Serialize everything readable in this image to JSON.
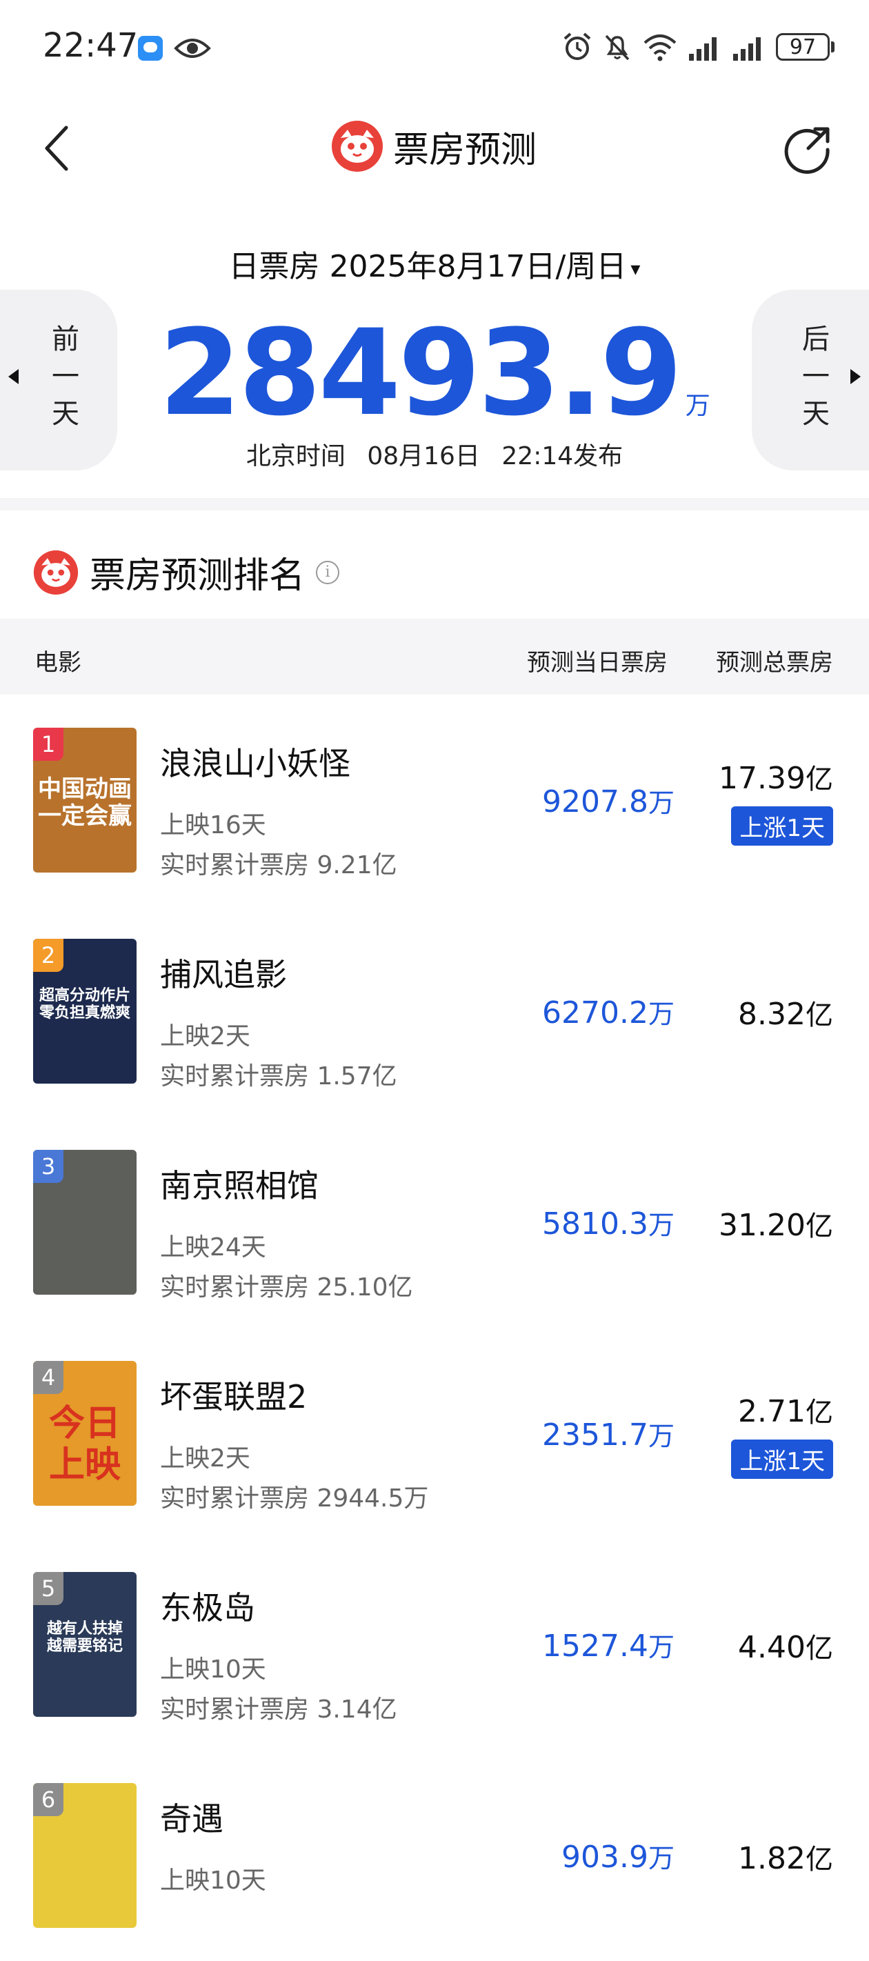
{
  "status_bar": {
    "time": "22:47",
    "battery": "97",
    "icons": [
      "message-icon",
      "eye-icon",
      "alarm-icon",
      "mute-icon",
      "wifi-icon",
      "signal-icon",
      "signal-icon",
      "battery-icon"
    ]
  },
  "header": {
    "title": "票房预测",
    "icons": [
      "back-icon",
      "cat-logo-icon",
      "share-icon"
    ]
  },
  "date": {
    "prefix": "日票房",
    "value": "2025年8月17日/周日",
    "caret": "▾"
  },
  "box_office": {
    "value": "28493.9",
    "unit": "万"
  },
  "publish": {
    "label": "北京时间",
    "date": "08月16日",
    "time": "22:14发布"
  },
  "nav": {
    "prev": "前一天",
    "next": "后一天"
  },
  "ranking": {
    "title": "票房预测排名",
    "columns": [
      "电影",
      "预测当日票房",
      "预测总票房"
    ],
    "rows": [
      {
        "rank": "1",
        "title": "浪浪山小妖怪",
        "days": "上映16天",
        "cumulative": "实时累计票房 9.21亿",
        "today": "9207.8",
        "today_unit": "万",
        "total": "17.39",
        "total_unit": "亿",
        "badge": "上涨1天",
        "poster_text": "中国动画\n一定会赢",
        "poster_color": "#b8722c",
        "rank_color": "#e8384a"
      },
      {
        "rank": "2",
        "title": "捕风追影",
        "days": "上映2天",
        "cumulative": "实时累计票房 1.57亿",
        "today": "6270.2",
        "today_unit": "万",
        "total": "8.32",
        "total_unit": "亿",
        "badge": "",
        "poster_text": "超高分动作片\n零负担真燃爽",
        "poster_color": "#1d2a4e",
        "rank_color": "#f49b2a"
      },
      {
        "rank": "3",
        "title": "南京照相馆",
        "days": "上映24天",
        "cumulative": "实时累计票房 25.10亿",
        "today": "5810.3",
        "today_unit": "万",
        "total": "31.20",
        "total_unit": "亿",
        "badge": "",
        "poster_text": "",
        "poster_color": "#5d5f5a",
        "rank_color": "#4a78d6"
      },
      {
        "rank": "4",
        "title": "坏蛋联盟2",
        "days": "上映2天",
        "cumulative": "实时累计票房 2944.5万",
        "today": "2351.7",
        "today_unit": "万",
        "total": "2.71",
        "total_unit": "亿",
        "badge": "上涨1天",
        "poster_text": "今日\n上映",
        "poster_color": "#e59a2a",
        "rank_color": "#8c8c8c"
      },
      {
        "rank": "5",
        "title": "东极岛",
        "days": "上映10天",
        "cumulative": "实时累计票房 3.14亿",
        "today": "1527.4",
        "today_unit": "万",
        "total": "4.40",
        "total_unit": "亿",
        "badge": "",
        "poster_text": "越有人扶掉\n越需要铭记",
        "poster_color": "#2a3a58",
        "rank_color": "#8c8c8c"
      },
      {
        "rank": "6",
        "title": "奇遇",
        "days": "上映10天",
        "cumulative": "",
        "today": "903.9",
        "today_unit": "万",
        "total": "1.82",
        "total_unit": "亿",
        "badge": "",
        "poster_text": "",
        "poster_color": "#e8c93a",
        "rank_color": "#8c8c8c"
      }
    ]
  }
}
